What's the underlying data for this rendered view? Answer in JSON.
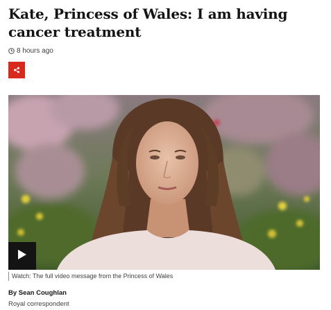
{
  "article": {
    "headline": "Kate, Princess of Wales: I am having cancer treatment",
    "timestamp": "8 hours ago",
    "share_icon": "share-icon",
    "media": {
      "play_icon": "play-icon",
      "caption": "Watch: The full video message from the Princess of Wales"
    },
    "byline": {
      "author": "By Sean Coughlan",
      "role": "Royal correspondent"
    }
  },
  "colors": {
    "share_button": "#d7291d",
    "play_button": "#141414",
    "text": "#141414",
    "meta_text": "#3f3f42"
  }
}
